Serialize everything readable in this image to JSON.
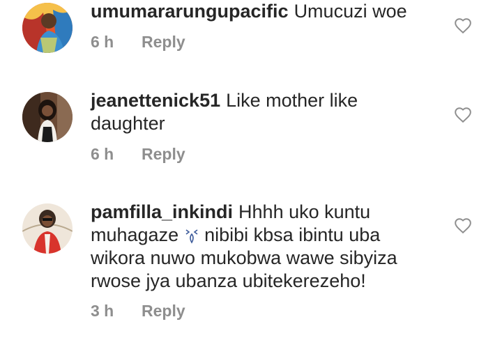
{
  "comments": [
    {
      "username": "umumararungupacific",
      "text": "Umucuzi woe",
      "time": "6 h",
      "reply_label": "Reply",
      "avatar_colors": [
        "#c0392b",
        "#1f6fb2",
        "#f2a93b"
      ]
    },
    {
      "username": "jeanettenick51",
      "text": "Like mother like daughter",
      "time": "6 h",
      "reply_label": "Reply",
      "avatar_colors": [
        "#5a3b2a",
        "#2b1b12",
        "#e9e4dc"
      ]
    },
    {
      "username": "pamfilla_inkindi",
      "text_before_emoji": "Hhhh  uko kuntu muhagaze",
      "emoji": "weary-face-emoji",
      "text_after_emoji": " nibibi kbsa ibintu uba wikora nuwo mukobwa wawe sibyiza rwose  jya ubanza ubitekerezeho!",
      "time": "3 h",
      "reply_label": "Reply",
      "avatar_colors": [
        "#d8342c",
        "#efe4d6",
        "#3a2a20"
      ]
    }
  ],
  "icons": {
    "like": "heart-outline-icon"
  },
  "colors": {
    "text": "#262626",
    "meta": "#8e8e8e",
    "heart": "#8e8e8e"
  }
}
